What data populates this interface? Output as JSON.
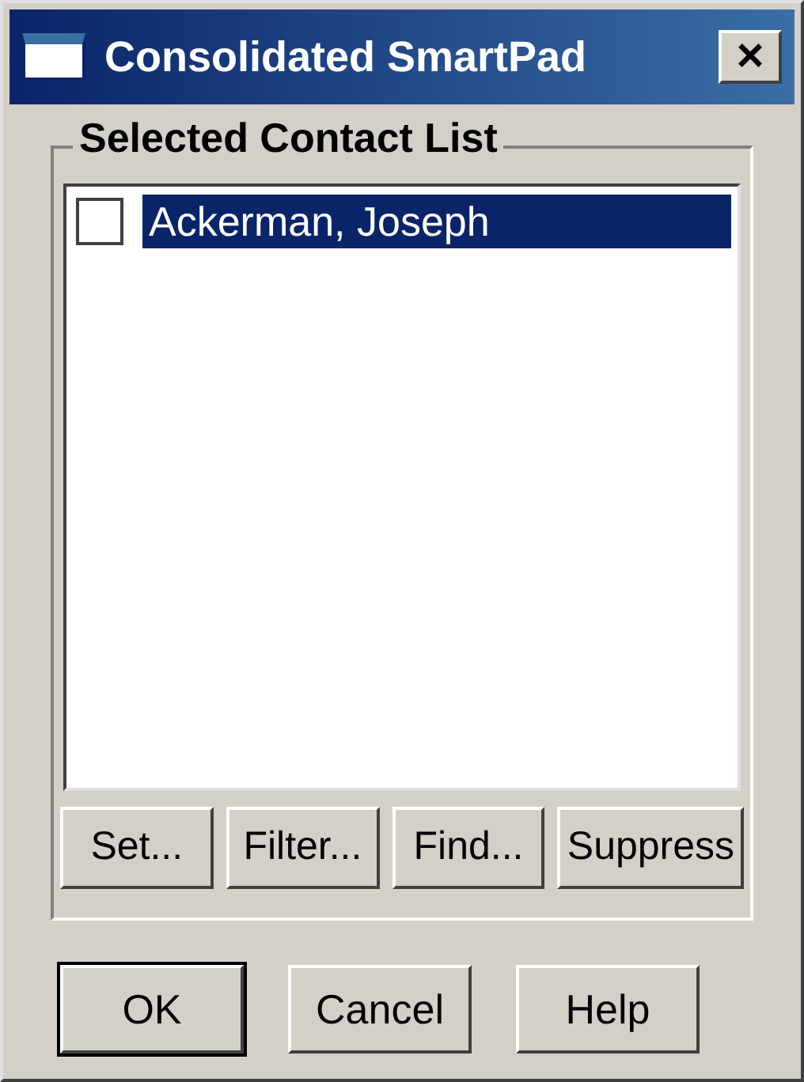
{
  "window": {
    "title": "Consolidated SmartPad",
    "close": "×"
  },
  "group": {
    "title": "Selected Contact List"
  },
  "contacts": [
    {
      "name": "Ackerman, Joseph",
      "checked": false,
      "selected": true
    }
  ],
  "list_buttons": [
    "Set...",
    "Filter...",
    "Find...",
    "Suppress"
  ],
  "dialog_buttons": [
    {
      "label": "OK",
      "default": true
    },
    {
      "label": "Cancel",
      "default": false
    },
    {
      "label": "Help",
      "default": false
    }
  ]
}
